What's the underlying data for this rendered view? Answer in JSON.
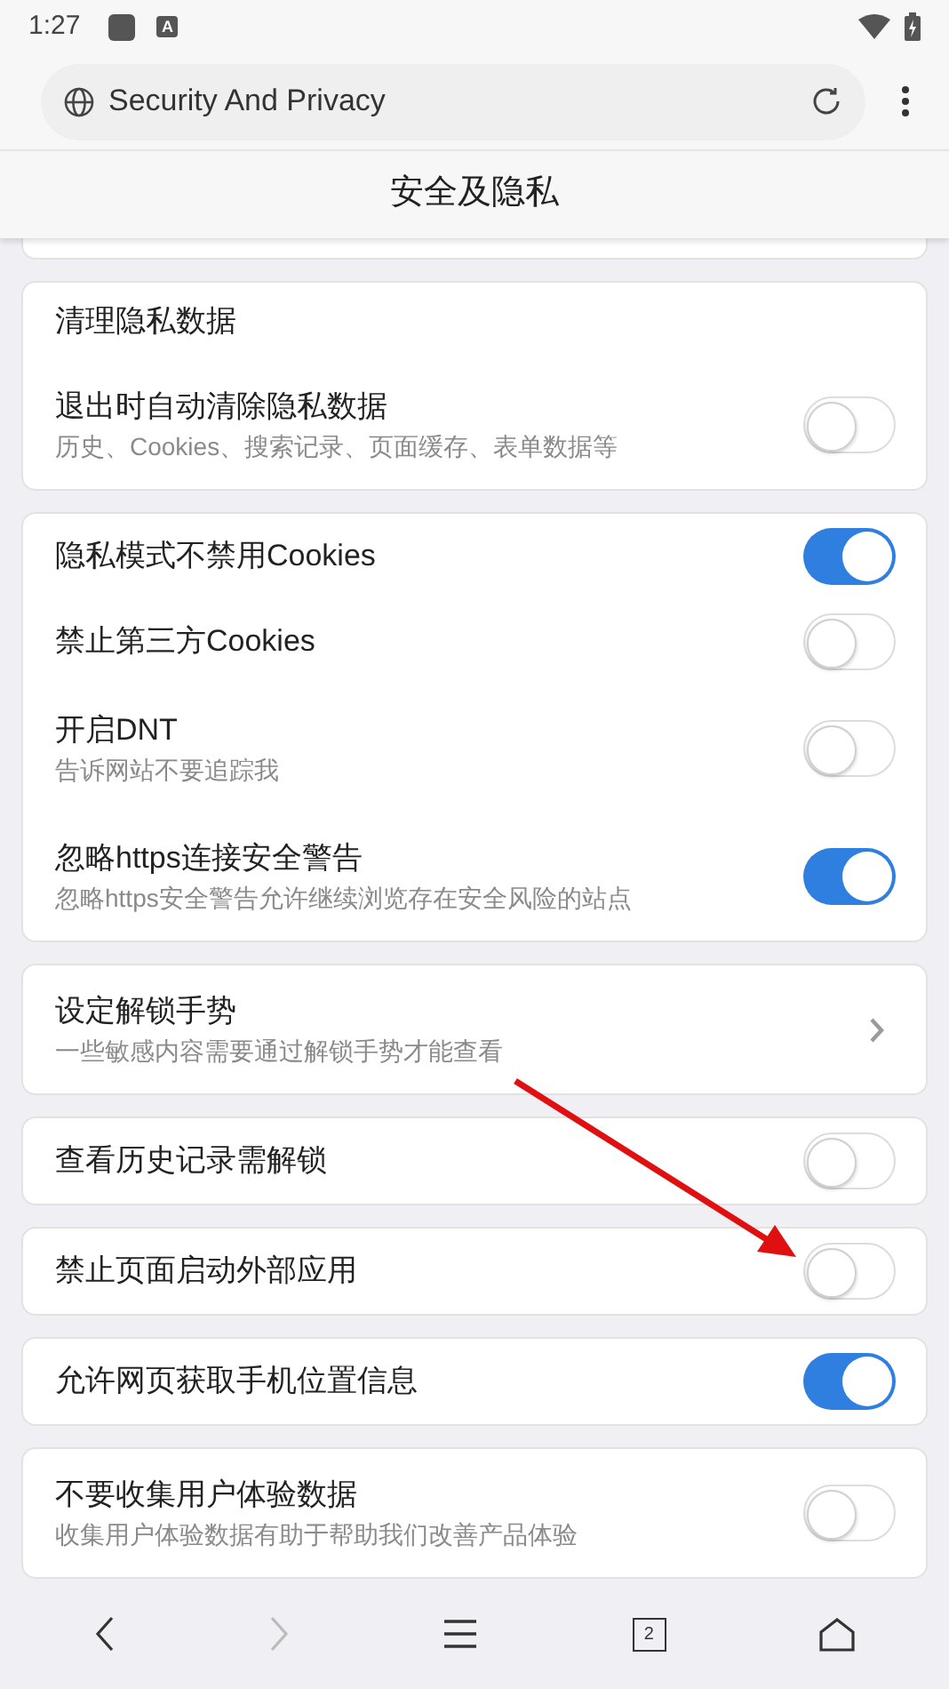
{
  "status_bar": {
    "time": "1:27",
    "notification_icon_letter": "A"
  },
  "address_bar": {
    "title": "Security And Privacy"
  },
  "page_title": "安全及隐私",
  "sections": [
    {
      "items": [
        {
          "kind": "header",
          "title": "清理隐私数据"
        },
        {
          "kind": "toggle",
          "title": "退出时自动清除隐私数据",
          "subtitle": "历史、Cookies、搜索记录、页面缓存、表单数据等",
          "on": false
        }
      ]
    },
    {
      "items": [
        {
          "kind": "toggle",
          "title": "隐私模式不禁用Cookies",
          "on": true
        },
        {
          "kind": "toggle",
          "title": "禁止第三方Cookies",
          "on": false
        },
        {
          "kind": "toggle",
          "title": "开启DNT",
          "subtitle": "告诉网站不要追踪我",
          "on": false
        },
        {
          "kind": "toggle",
          "title": "忽略https连接安全警告",
          "subtitle": "忽略https安全警告允许继续浏览存在安全风险的站点",
          "on": true
        }
      ]
    },
    {
      "items": [
        {
          "kind": "link",
          "title": "设定解锁手势",
          "subtitle": "一些敏感内容需要通过解锁手势才能查看"
        }
      ]
    },
    {
      "items": [
        {
          "kind": "toggle",
          "title": "查看历史记录需解锁",
          "on": false
        }
      ]
    },
    {
      "items": [
        {
          "kind": "toggle",
          "title": "禁止页面启动外部应用",
          "on": false
        }
      ]
    },
    {
      "items": [
        {
          "kind": "toggle",
          "title": "允许网页获取手机位置信息",
          "on": true
        }
      ]
    },
    {
      "items": [
        {
          "kind": "toggle",
          "title": "不要收集用户体验数据",
          "subtitle": "收集用户体验数据有助于帮助我们改善产品体验",
          "on": false
        }
      ]
    }
  ],
  "bottom_nav": {
    "back_disabled": false,
    "forward_disabled": true,
    "tab_count": "2"
  }
}
